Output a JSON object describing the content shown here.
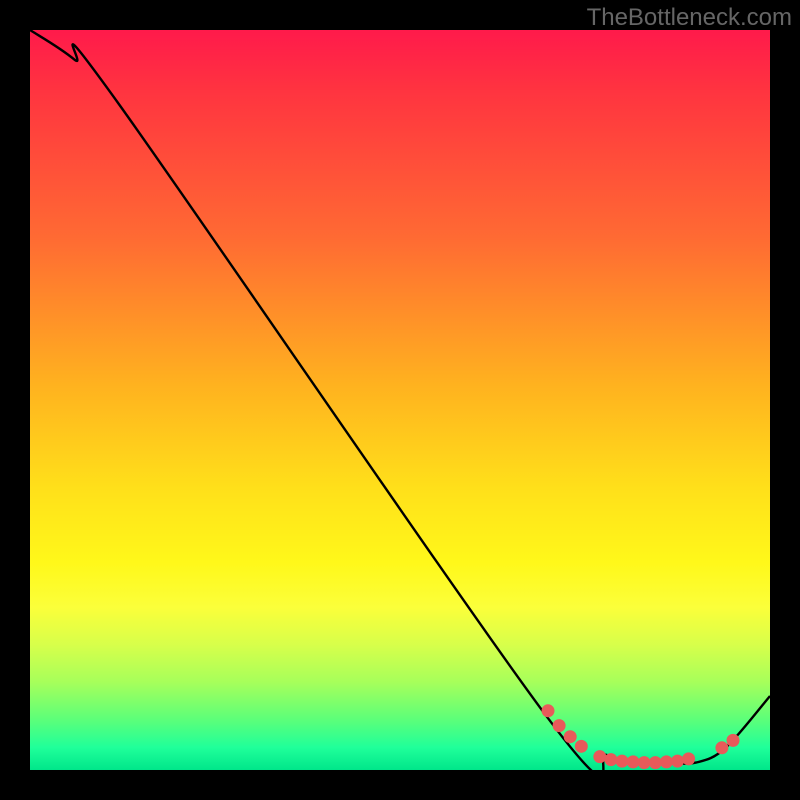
{
  "watermark": "TheBottleneck.com",
  "chart_data": {
    "type": "line",
    "title": "",
    "xlabel": "",
    "ylabel": "",
    "xlim": [
      0,
      100
    ],
    "ylim": [
      0,
      100
    ],
    "series": [
      {
        "name": "curve",
        "x": [
          0,
          6,
          12,
          70,
          78,
          82,
          86,
          90,
          94,
          100
        ],
        "y": [
          100,
          96,
          90,
          7,
          2,
          1,
          1,
          1,
          3,
          10
        ]
      }
    ],
    "markers": [
      {
        "x": 70.0,
        "y": 8.0
      },
      {
        "x": 71.5,
        "y": 6.0
      },
      {
        "x": 73.0,
        "y": 4.5
      },
      {
        "x": 74.5,
        "y": 3.2
      },
      {
        "x": 77.0,
        "y": 1.8
      },
      {
        "x": 78.5,
        "y": 1.4
      },
      {
        "x": 80.0,
        "y": 1.2
      },
      {
        "x": 81.5,
        "y": 1.1
      },
      {
        "x": 83.0,
        "y": 1.0
      },
      {
        "x": 84.5,
        "y": 1.0
      },
      {
        "x": 86.0,
        "y": 1.1
      },
      {
        "x": 87.5,
        "y": 1.2
      },
      {
        "x": 89.0,
        "y": 1.5
      },
      {
        "x": 93.5,
        "y": 3.0
      },
      {
        "x": 95.0,
        "y": 4.0
      }
    ],
    "gradient_stops": [
      {
        "pos": 0.0,
        "color": "#ff1a4b"
      },
      {
        "pos": 0.08,
        "color": "#ff3340"
      },
      {
        "pos": 0.28,
        "color": "#ff6a33"
      },
      {
        "pos": 0.48,
        "color": "#ffb21f"
      },
      {
        "pos": 0.62,
        "color": "#ffe01a"
      },
      {
        "pos": 0.72,
        "color": "#fff81a"
      },
      {
        "pos": 0.78,
        "color": "#fbff3a"
      },
      {
        "pos": 0.83,
        "color": "#d8ff4a"
      },
      {
        "pos": 0.88,
        "color": "#a8ff5a"
      },
      {
        "pos": 0.93,
        "color": "#5fff78"
      },
      {
        "pos": 0.97,
        "color": "#1fff9a"
      },
      {
        "pos": 1.0,
        "color": "#00e68a"
      }
    ],
    "marker_color": "#e85a5a",
    "curve_color": "#000000"
  }
}
